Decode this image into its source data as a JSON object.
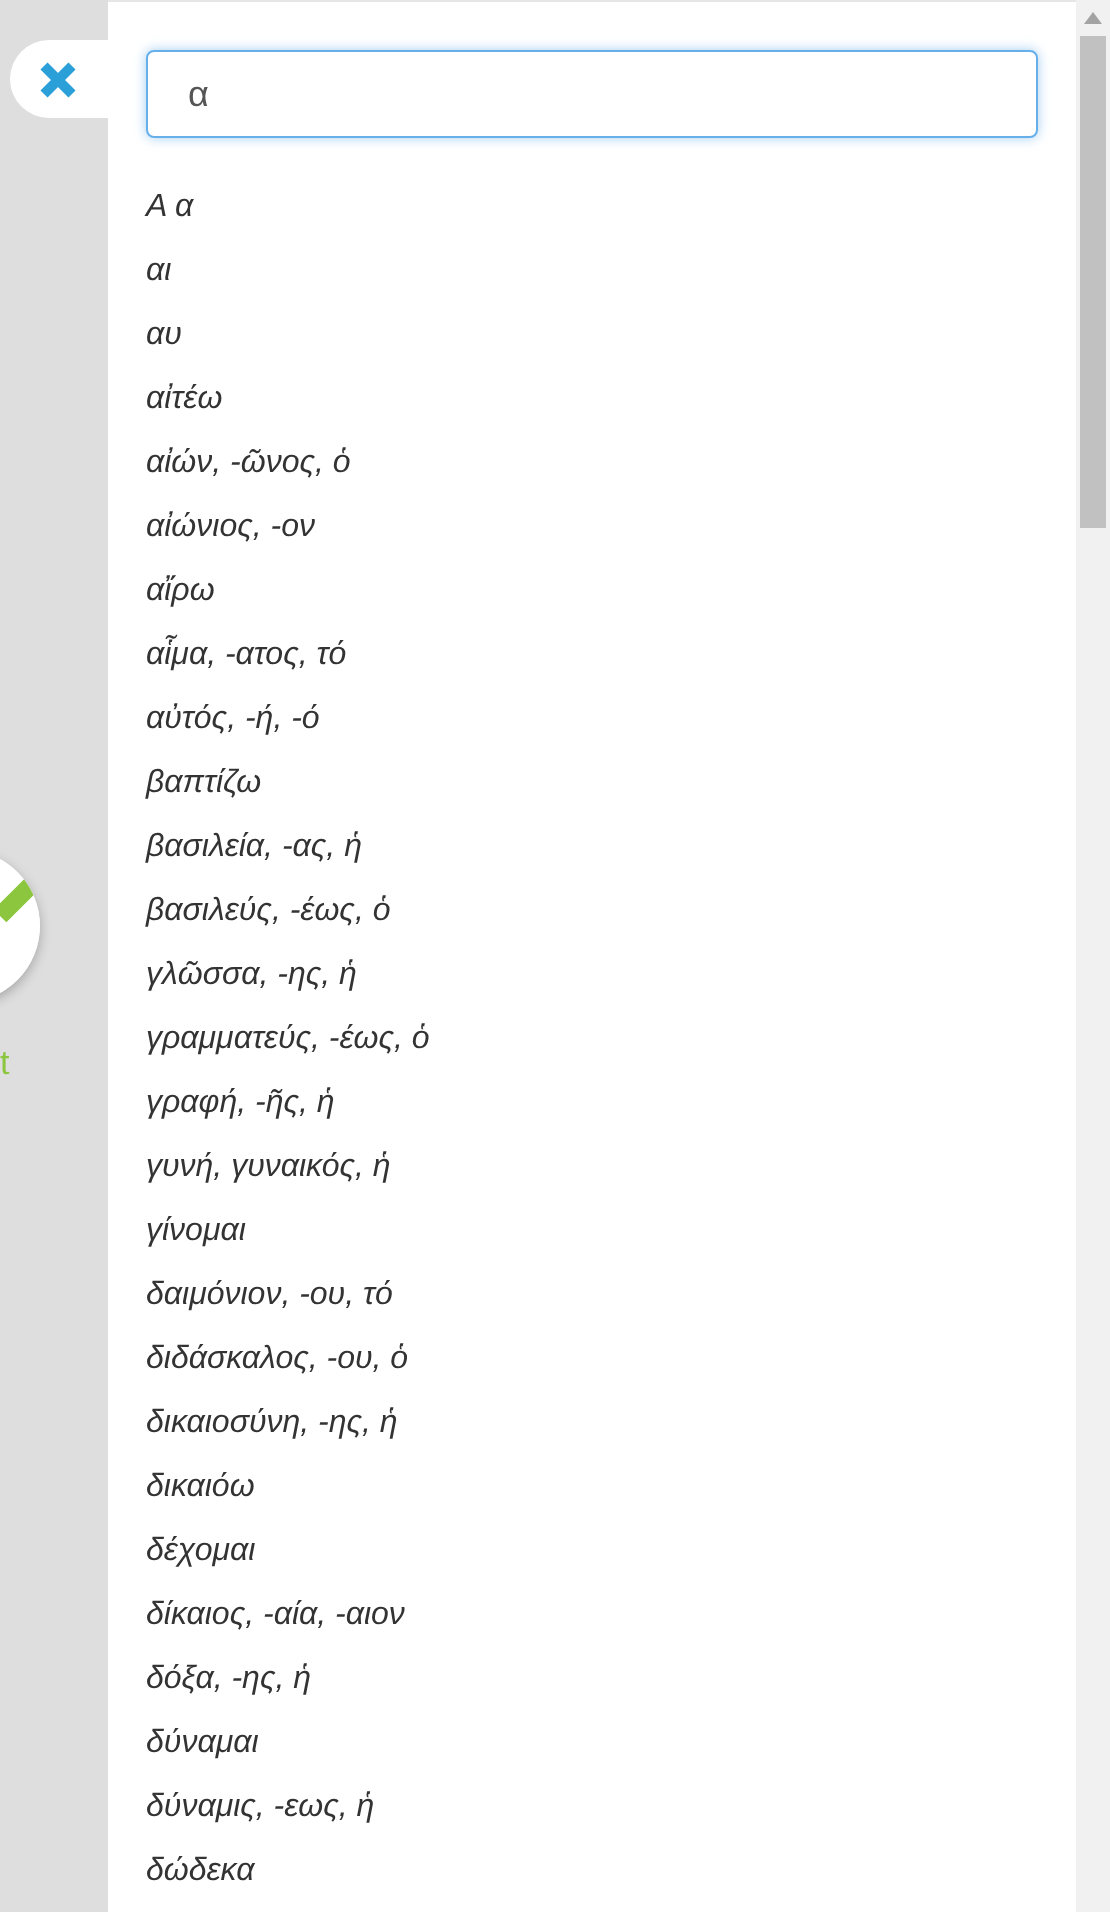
{
  "side_panel": {
    "label": "t"
  },
  "search": {
    "value": "α"
  },
  "entries": [
    "Α α",
    "αι",
    "αυ",
    "αἰτέω",
    "αἰών, -ῶνος, ὁ",
    "αἰώνιος, -ον",
    "αἴρω",
    "αἷμα, -ατος, τό",
    "αὐτός, -ή, -ό",
    "βαπτίζω",
    "βασιλεία, -ας, ἡ",
    "βασιλεύς, -έως, ὁ",
    "γλῶσσα, -ης, ἡ",
    "γραμματεύς, -έως, ὁ",
    "γραφή, -ῆς, ἡ",
    "γυνή, γυναικός, ἡ",
    "γίνομαι",
    "δαιμόνιον, -ου, τό",
    "διδάσκαλος, -ου, ὁ",
    "δικαιοσύνη, -ης, ἡ",
    "δικαιόω",
    "δέχομαι",
    "δίκαιος, -αία, -αιον",
    "δόξα, -ης, ἡ",
    "δύναμαι",
    "δύναμις, -εως, ἡ",
    "δώδεκα"
  ]
}
